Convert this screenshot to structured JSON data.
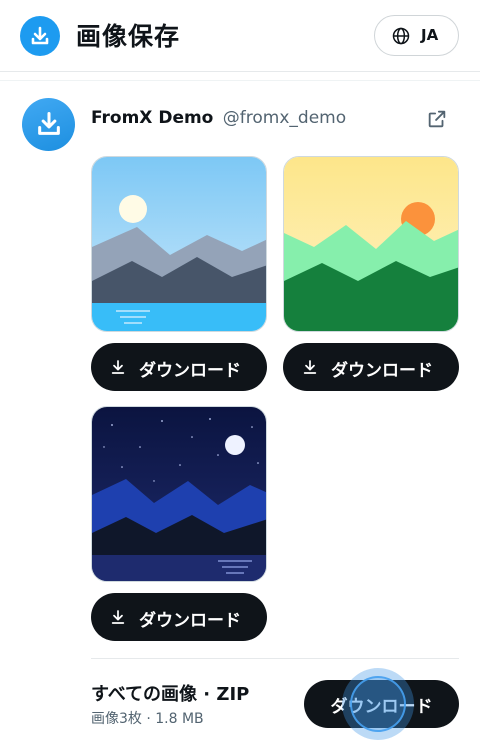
{
  "header": {
    "title": "画像保存",
    "language_label": "JA",
    "icon": "download-icon",
    "brand_color": "#1d9bf0"
  },
  "post": {
    "display_name": "FromX Demo",
    "handle": "@fromx_demo",
    "avatar_icon": "download-icon",
    "open_icon": "external-link-icon"
  },
  "images": [
    {
      "theme": "day-lake",
      "button_label": "ダウンロード"
    },
    {
      "theme": "sunset-hills",
      "button_label": "ダウンロード"
    },
    {
      "theme": "night-lake",
      "button_label": "ダウンロード"
    }
  ],
  "zip": {
    "title": "すべての画像 · ZIP",
    "subtitle": "画像3枚 · 1.8 MB",
    "button_label": "ダウンロード"
  }
}
